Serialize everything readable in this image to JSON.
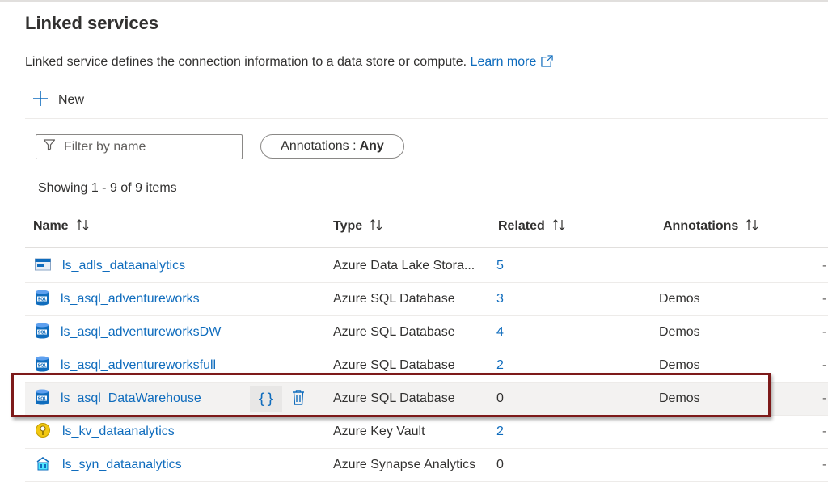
{
  "page": {
    "title": "Linked services",
    "description": "Linked service defines the connection information to a data store or compute.",
    "learn_more": "Learn more"
  },
  "toolbar": {
    "new_label": "New"
  },
  "filter": {
    "placeholder": "Filter by name",
    "value": ""
  },
  "annotations_filter": {
    "label": "Annotations :",
    "value": "Any"
  },
  "showing": "Showing 1 - 9 of 9 items",
  "columns": {
    "name": "Name",
    "type": "Type",
    "related": "Related",
    "annotations": "Annotations"
  },
  "rows": [
    {
      "icon": "data-lake-storage-icon",
      "name": "ls_adls_dataanalytics",
      "type": "Azure Data Lake Stora...",
      "related": "5",
      "annotations": "",
      "trailing": "-"
    },
    {
      "icon": "sql-database-icon",
      "name": "ls_asql_adventureworks",
      "type": "Azure SQL Database",
      "related": "3",
      "annotations": "Demos",
      "trailing": "-"
    },
    {
      "icon": "sql-database-icon",
      "name": "ls_asql_adventureworksDW",
      "type": "Azure SQL Database",
      "related": "4",
      "annotations": "Demos",
      "trailing": "-"
    },
    {
      "icon": "sql-database-icon",
      "name": "ls_asql_adventureworksfull",
      "type": "Azure SQL Database",
      "related": "2",
      "annotations": "Demos",
      "trailing": "-"
    },
    {
      "icon": "sql-database-icon",
      "name": "ls_asql_DataWarehouse",
      "type": "Azure SQL Database",
      "related": "0",
      "annotations": "Demos",
      "trailing": "-",
      "selected": true
    },
    {
      "icon": "key-vault-icon",
      "name": "ls_kv_dataanalytics",
      "type": "Azure Key Vault",
      "related": "2",
      "annotations": "",
      "trailing": "-"
    },
    {
      "icon": "synapse-analytics-icon",
      "name": "ls_syn_dataanalytics",
      "type": "Azure Synapse Analytics",
      "related": "0",
      "annotations": "",
      "trailing": "-"
    }
  ],
  "row_actions": {
    "code_glyph": "{}"
  },
  "colors": {
    "link": "#0f6cbd",
    "text": "#323130",
    "highlight_border": "#7d1a1a",
    "selected_row": "#f3f2f1"
  }
}
